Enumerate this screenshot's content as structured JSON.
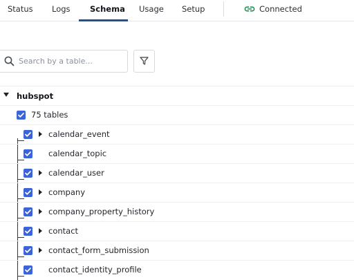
{
  "tabs": [
    {
      "label": "Status",
      "active": false
    },
    {
      "label": "Logs",
      "active": false
    },
    {
      "label": "Schema",
      "active": true
    },
    {
      "label": "Usage",
      "active": false
    },
    {
      "label": "Setup",
      "active": false
    }
  ],
  "connection": {
    "label": "Connected",
    "icon": "link-icon",
    "color": "#1e8e4e"
  },
  "search": {
    "placeholder": "Search by a table...",
    "value": "",
    "icon": "search-icon"
  },
  "filter": {
    "icon": "filter-icon"
  },
  "schema": {
    "name": "hubspot",
    "expanded": true,
    "select_all": {
      "label": "75 tables",
      "checked": true
    },
    "tables": [
      {
        "name": "calendar_event",
        "checked": true,
        "expandable": true
      },
      {
        "name": "calendar_topic",
        "checked": true,
        "expandable": false
      },
      {
        "name": "calendar_user",
        "checked": true,
        "expandable": true
      },
      {
        "name": "company",
        "checked": true,
        "expandable": true
      },
      {
        "name": "company_property_history",
        "checked": true,
        "expandable": true
      },
      {
        "name": "contact",
        "checked": true,
        "expandable": true
      },
      {
        "name": "contact_form_submission",
        "checked": true,
        "expandable": true
      },
      {
        "name": "contact_identity_profile",
        "checked": true,
        "expandable": false
      }
    ]
  },
  "colors": {
    "accent": "#3a64d8",
    "tab_underline": "#2f4f7a"
  }
}
